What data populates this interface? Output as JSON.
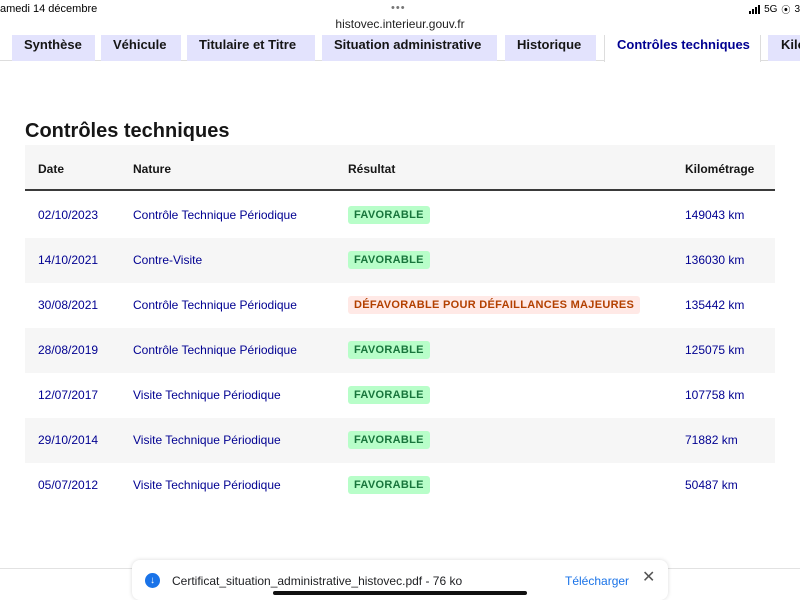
{
  "status_bar": {
    "date": "amedi 14 décembre",
    "dots": "•••",
    "network": "5G",
    "battery": "3"
  },
  "browser": {
    "url": "histovec.interieur.gouv.fr"
  },
  "tabs": [
    {
      "label": "Synthèse",
      "active": false
    },
    {
      "label": "Véhicule",
      "active": false
    },
    {
      "label": "Titulaire et Titre",
      "active": false
    },
    {
      "label": "Situation administrative",
      "active": false
    },
    {
      "label": "Historique",
      "active": false
    },
    {
      "label": "Contrôles techniques",
      "active": true
    },
    {
      "label": "Kilo",
      "active": false
    }
  ],
  "section": {
    "title": "Contrôles techniques"
  },
  "table": {
    "headers": {
      "date": "Date",
      "nature": "Nature",
      "result": "Résultat",
      "km": "Kilométrage"
    },
    "rows": [
      {
        "date": "02/10/2023",
        "nature": "Contrôle Technique Périodique",
        "result": "FAVORABLE",
        "status": "ok",
        "km": "149043 km"
      },
      {
        "date": "14/10/2021",
        "nature": "Contre-Visite",
        "result": "FAVORABLE",
        "status": "ok",
        "km": "136030 km"
      },
      {
        "date": "30/08/2021",
        "nature": "Contrôle Technique Périodique",
        "result": "DÉFAVORABLE POUR DÉFAILLANCES MAJEURES",
        "status": "ko",
        "km": "135442 km"
      },
      {
        "date": "28/08/2019",
        "nature": "Contrôle Technique Périodique",
        "result": "FAVORABLE",
        "status": "ok",
        "km": "125075 km"
      },
      {
        "date": "12/07/2017",
        "nature": "Visite Technique Périodique",
        "result": "FAVORABLE",
        "status": "ok",
        "km": "107758 km"
      },
      {
        "date": "29/10/2014",
        "nature": "Visite Technique Périodique",
        "result": "FAVORABLE",
        "status": "ok",
        "km": "71882 km"
      },
      {
        "date": "05/07/2012",
        "nature": "Visite Technique Périodique",
        "result": "FAVORABLE",
        "status": "ok",
        "km": "50487 km"
      }
    ]
  },
  "download": {
    "filename": "Certificat_situation_administrative_histovec.pdf - 76 ko",
    "action": "Télécharger",
    "close": "✕"
  },
  "colors": {
    "tab_bg": "#e3e3fd",
    "accent": "#000091",
    "success_bg": "#b8fec9",
    "success_text": "#18753c",
    "error_bg": "#ffe9e6",
    "error_text": "#b34000",
    "link_blue": "#1a73e8"
  },
  "icons": [
    "signal-icon",
    "location-icon",
    "download-icon",
    "close-icon"
  ]
}
